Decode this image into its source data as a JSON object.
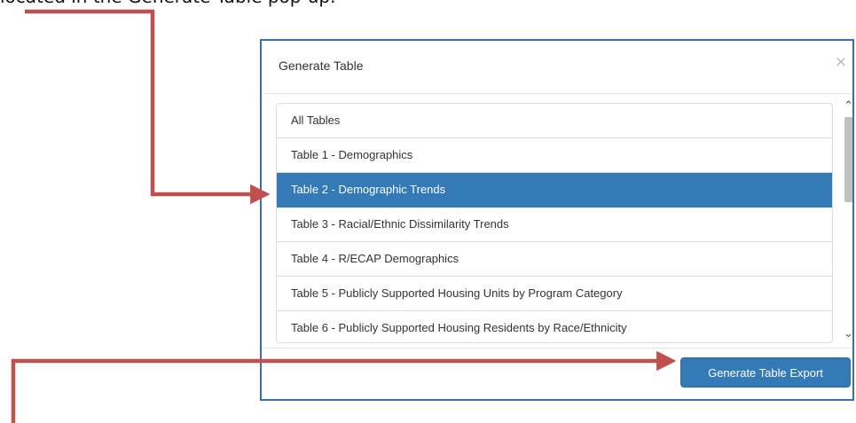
{
  "caption": {
    "text": "located in the Generate Table pop-up."
  },
  "dialog": {
    "title": "Generate Table",
    "close_glyph": "×",
    "items": [
      {
        "label": "All Tables",
        "selected": false
      },
      {
        "label": "Table 1 - Demographics",
        "selected": false
      },
      {
        "label": "Table 2 - Demographic Trends",
        "selected": true
      },
      {
        "label": "Table 3 - Racial/Ethnic Dissimilarity Trends",
        "selected": false
      },
      {
        "label": "Table 4 - R/ECAP Demographics",
        "selected": false
      },
      {
        "label": "Table 5 - Publicly Supported Housing Units by Program Category",
        "selected": false
      },
      {
        "label": "Table 6 - Publicly Supported Housing Residents by Race/Ethnicity",
        "selected": false
      }
    ],
    "export_button_label": "Generate Table Export"
  },
  "colors": {
    "accent": "#337ab7",
    "modal_border": "#3a6fb0",
    "annotation_arrow": "#c0504d"
  },
  "icons": {
    "close": "close-icon",
    "scroll_up": "chevron-up-icon",
    "scroll_down": "chevron-down-icon",
    "arrow": "arrow-right-icon"
  }
}
